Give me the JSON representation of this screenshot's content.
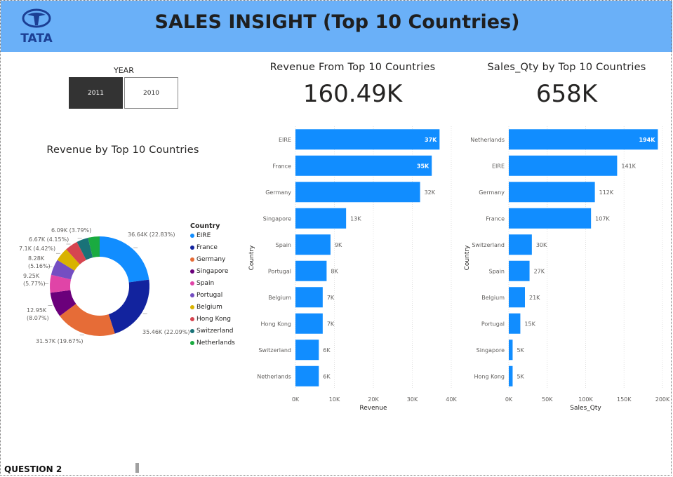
{
  "header": {
    "title": "SALES INSIGHT (Top 10 Countries)",
    "logo_text": "TATA",
    "background": "#6ab0f8"
  },
  "slicer": {
    "label": "YEAR",
    "options": [
      "2011",
      "2010"
    ],
    "selected": "2011"
  },
  "donut": {
    "title": "Revenue by Top 10 Countries",
    "legend_title": "Country",
    "slices": [
      {
        "name": "EIRE",
        "value": 36.64,
        "label": "36.64K (22.83%)",
        "color": "#118dff"
      },
      {
        "name": "France",
        "value": 35.46,
        "label": "35.46K (22.09%)",
        "color": "#12239e"
      },
      {
        "name": "Germany",
        "value": 31.57,
        "label": "31.57K (19.67%)",
        "color": "#e66c37"
      },
      {
        "name": "Singapore",
        "value": 12.95,
        "label": "12.95K (8.07%)",
        "color": "#6b007b"
      },
      {
        "name": "Spain",
        "value": 9.25,
        "label": "9.25K (5.77%)",
        "color": "#e044a7"
      },
      {
        "name": "Portugal",
        "value": 8.28,
        "label": "8.28K (5.16%)",
        "color": "#744ec2"
      },
      {
        "name": "Belgium",
        "value": 7.1,
        "label": "7.1K (4.42%)",
        "color": "#d9b300"
      },
      {
        "name": "Hong Kong",
        "value": 6.67,
        "label": "6.67K (4.15%)",
        "color": "#d64550"
      },
      {
        "name": "Switzerland",
        "value": 6.09,
        "label": "6.09K (3.79%)",
        "color": "#197278"
      },
      {
        "name": "Netherlands",
        "value": 6.0,
        "label": "",
        "color": "#1aab40"
      }
    ]
  },
  "kpi_revenue": {
    "title": "Revenue From Top 10 Countries",
    "value": "160.49K"
  },
  "kpi_qty": {
    "title": "Sales_Qty by Top 10 Countries",
    "value": "658K"
  },
  "chart_data": [
    {
      "type": "bar",
      "orientation": "horizontal",
      "xlabel": "Revenue",
      "ylabel": "Country",
      "xlim": [
        0,
        40
      ],
      "ticks": [
        "0K",
        "10K",
        "20K",
        "30K",
        "40K"
      ],
      "categories": [
        "EIRE",
        "France",
        "Germany",
        "Singapore",
        "Spain",
        "Portugal",
        "Belgium",
        "Hong Kong",
        "Switzerland",
        "Netherlands"
      ],
      "values": [
        37,
        35,
        32,
        13,
        9,
        8,
        7,
        7,
        6,
        6
      ],
      "labels": [
        "37K",
        "35K",
        "32K",
        "13K",
        "9K",
        "8K",
        "7K",
        "7K",
        "6K",
        "6K"
      ],
      "color": "#118dff"
    },
    {
      "type": "bar",
      "orientation": "horizontal",
      "xlabel": "Sales_Qty",
      "ylabel": "Country",
      "xlim": [
        0,
        200
      ],
      "ticks": [
        "0K",
        "50K",
        "100K",
        "150K",
        "200K"
      ],
      "categories": [
        "Netherlands",
        "EIRE",
        "Germany",
        "France",
        "Switzerland",
        "Spain",
        "Belgium",
        "Portugal",
        "Singapore",
        "Hong Kong"
      ],
      "values": [
        194,
        141,
        112,
        107,
        30,
        27,
        21,
        15,
        5,
        5
      ],
      "labels": [
        "194K",
        "141K",
        "112K",
        "107K",
        "30K",
        "27K",
        "21K",
        "15K",
        "5K",
        "5K"
      ],
      "color": "#118dff"
    }
  ],
  "footer": {
    "label": "QUESTION 2"
  }
}
